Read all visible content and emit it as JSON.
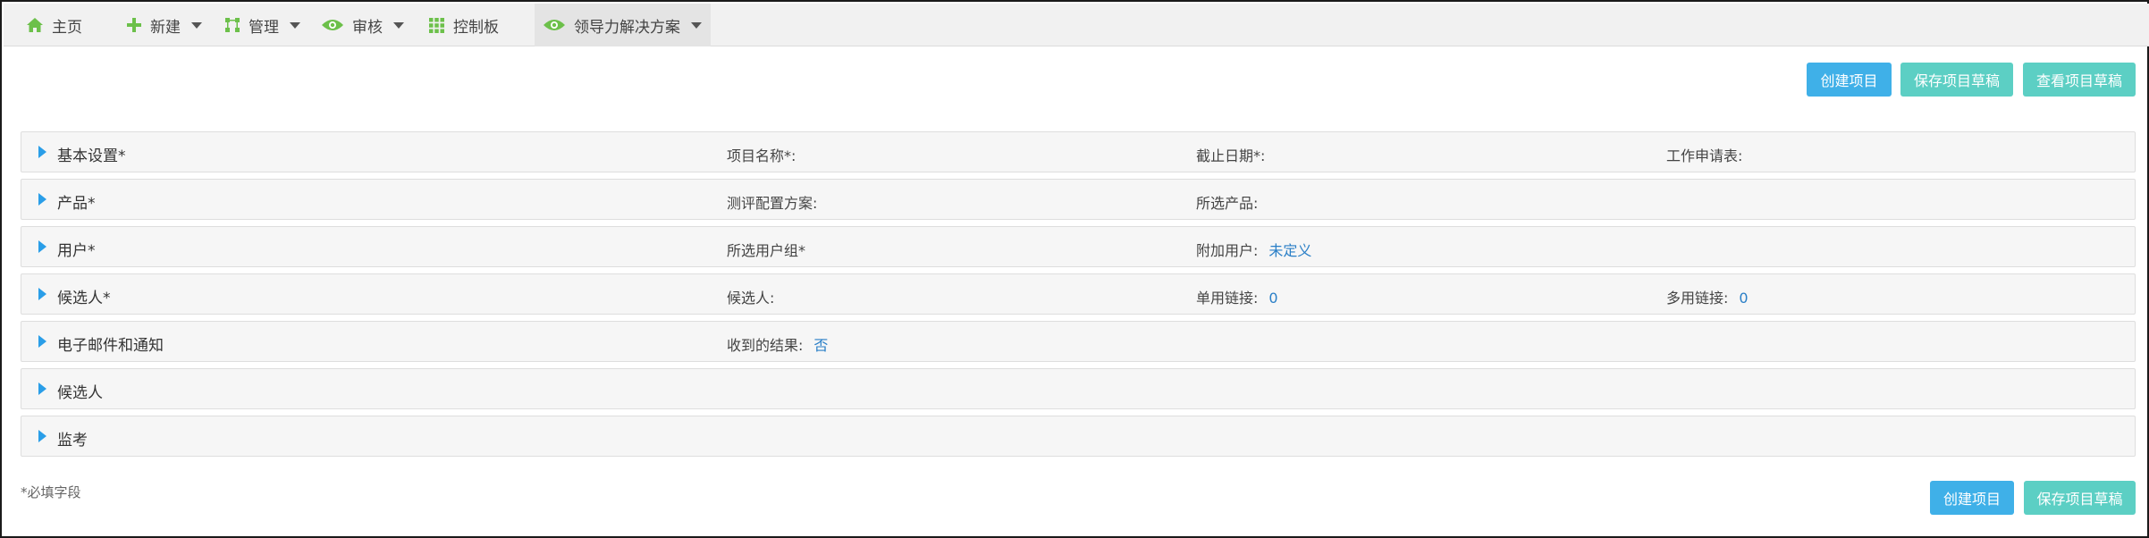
{
  "nav": {
    "items": [
      {
        "label": "主页",
        "icon": "home-icon",
        "caret": false
      },
      {
        "label": "新建",
        "icon": "plus-icon",
        "caret": true
      },
      {
        "label": "管理",
        "icon": "nodes-icon",
        "caret": true
      },
      {
        "label": "审核",
        "icon": "eye-icon",
        "caret": true
      },
      {
        "label": "控制板",
        "icon": "grid-icon",
        "caret": false
      },
      {
        "label": "领导力解决方案",
        "icon": "eye-icon",
        "caret": true
      }
    ]
  },
  "toolbar_top": {
    "create_label": "创建项目",
    "save_draft_label": "保存项目草稿",
    "view_draft_label": "查看项目草稿"
  },
  "sections": [
    {
      "title": "基本设置*",
      "fields": [
        {
          "label": "项目名称*:",
          "value": ""
        },
        {
          "label": "截止日期*:",
          "value": ""
        },
        {
          "label": "工作申请表:",
          "value": ""
        }
      ]
    },
    {
      "title": "产品*",
      "fields": [
        {
          "label": "测评配置方案:",
          "value": ""
        },
        {
          "label": "所选产品:",
          "value": ""
        }
      ]
    },
    {
      "title": "用户*",
      "fields": [
        {
          "label": "所选用户组*",
          "value": ""
        },
        {
          "label": "附加用户:",
          "value": "未定义"
        }
      ]
    },
    {
      "title": "候选人*",
      "fields": [
        {
          "label": "候选人:",
          "value": ""
        },
        {
          "label": "单用链接:",
          "value": "0"
        },
        {
          "label": "多用链接:",
          "value": "0"
        }
      ]
    },
    {
      "title": "电子邮件和通知",
      "fields": [
        {
          "label": "收到的结果:",
          "value": "否"
        }
      ]
    },
    {
      "title": "候选人",
      "fields": []
    },
    {
      "title": "监考",
      "fields": []
    }
  ],
  "footer": {
    "required_note": "*必填字段",
    "create_label": "创建项目",
    "save_draft_label": "保存项目草稿"
  },
  "colors": {
    "accent_blue": "#3fb0e8",
    "accent_teal": "#5ccfc4",
    "icon_green": "#6cc04a",
    "arrow_blue": "#2a9ee8",
    "link_blue": "#2a7fc7"
  }
}
